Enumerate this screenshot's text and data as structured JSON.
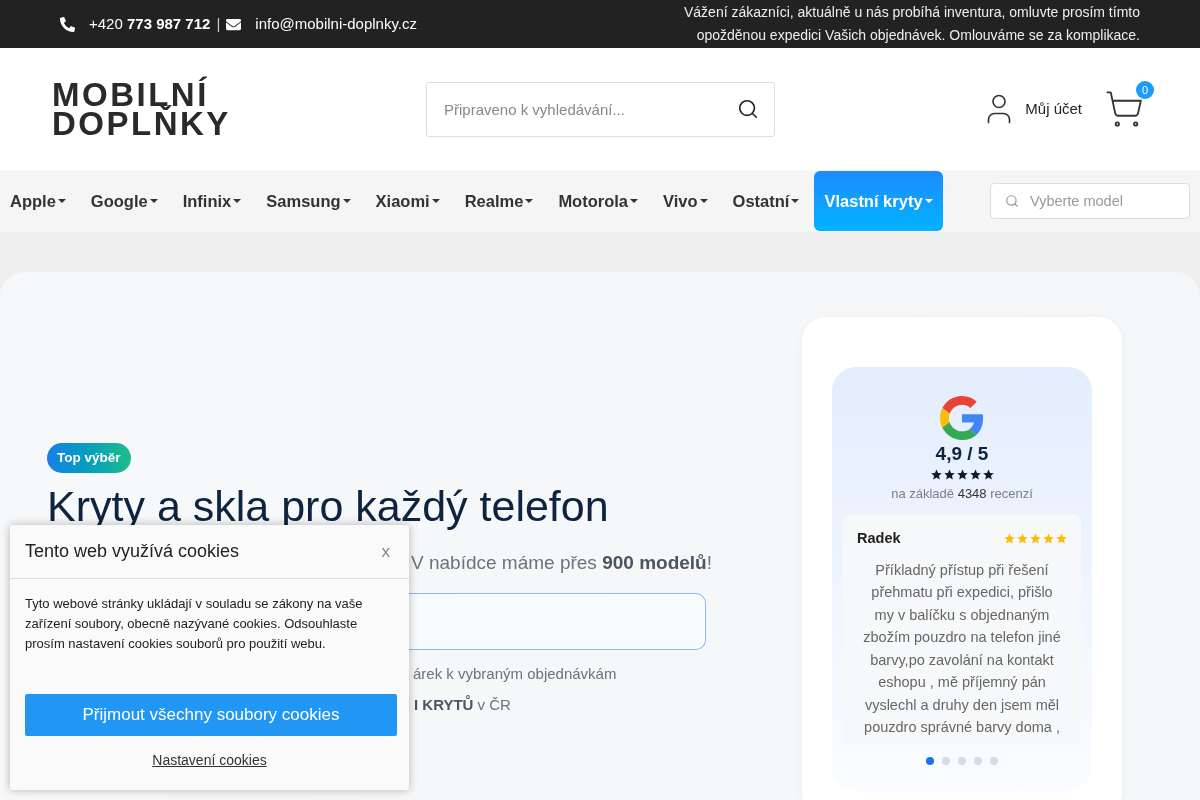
{
  "top_bar": {
    "phone": "+420 **773 987 712**",
    "separator": "|",
    "email": "info@mobilni-doplnky.cz",
    "notice": "Vážení zákazníci, aktuálně u nás probíhá inventura, omluvte prosím tímto opožděnou expedici Vašich objednávek. Omlouváme se za komplikace."
  },
  "header": {
    "logo": [
      "MOBILNÍ",
      "DOPLŇKY"
    ],
    "search": {
      "placeholder": "Připraveno k vyhledávání..."
    },
    "account": "Můj účet",
    "cart_count": "0"
  },
  "nav": {
    "items": [
      {
        "label": "Apple",
        "selected": false
      },
      {
        "label": "Google",
        "selected": false
      },
      {
        "label": "Infinix",
        "selected": false
      },
      {
        "label": "Samsung",
        "selected": false
      },
      {
        "label": "Xiaomi",
        "selected": false
      },
      {
        "label": "Realme",
        "selected": false
      },
      {
        "label": "Motorola",
        "selected": false
      },
      {
        "label": "Vivo",
        "selected": false
      },
      {
        "label": "Ostatní",
        "selected": false
      },
      {
        "label": "Vlastní kryty",
        "selected": true
      }
    ],
    "model_search": {
      "placeholder": "Vyberte model"
    }
  },
  "hero": {
    "badge": "Top výběr",
    "title": "Kryty a skla pro každý telefon",
    "subtitle": "V nabídce máme přes **900 modelů**!",
    "note_1": "árek k vybraným objednávkám",
    "note_2": "**I KRYTŮ** v ČR"
  },
  "reviews": {
    "rating": "4,9 / 5",
    "stars": 5,
    "summary": "na základě **4348** recenzí",
    "review": {
      "author": "Radek",
      "stars": 5,
      "text": "Příkladný přístup při řešení přehmatu při expedici, přišlo my v balíčku s objednaným zbožím pouzdro na telefon jiné barvy,po zavolání na kontakt eshopu , mě příjemný pán vyslechl a druhy den jsem měl pouzdro správné barvy doma ,"
    },
    "dots": [
      {
        "selected": true
      },
      {
        "selected": false
      },
      {
        "selected": false
      },
      {
        "selected": false
      },
      {
        "selected": false
      }
    ]
  },
  "cookie_popup": {
    "title": "Tento web využívá cookies",
    "close": "x",
    "text": "Tyto webové stránky ukládají v souladu se zákony na vaše zařízení soubory, obecně nazývané cookies. Odsouhlaste prosím nastavení cookies souborů pro použití webu.",
    "accept": "Přijmout všechny soubory cookies",
    "settings": "Nastavení cookies"
  }
}
